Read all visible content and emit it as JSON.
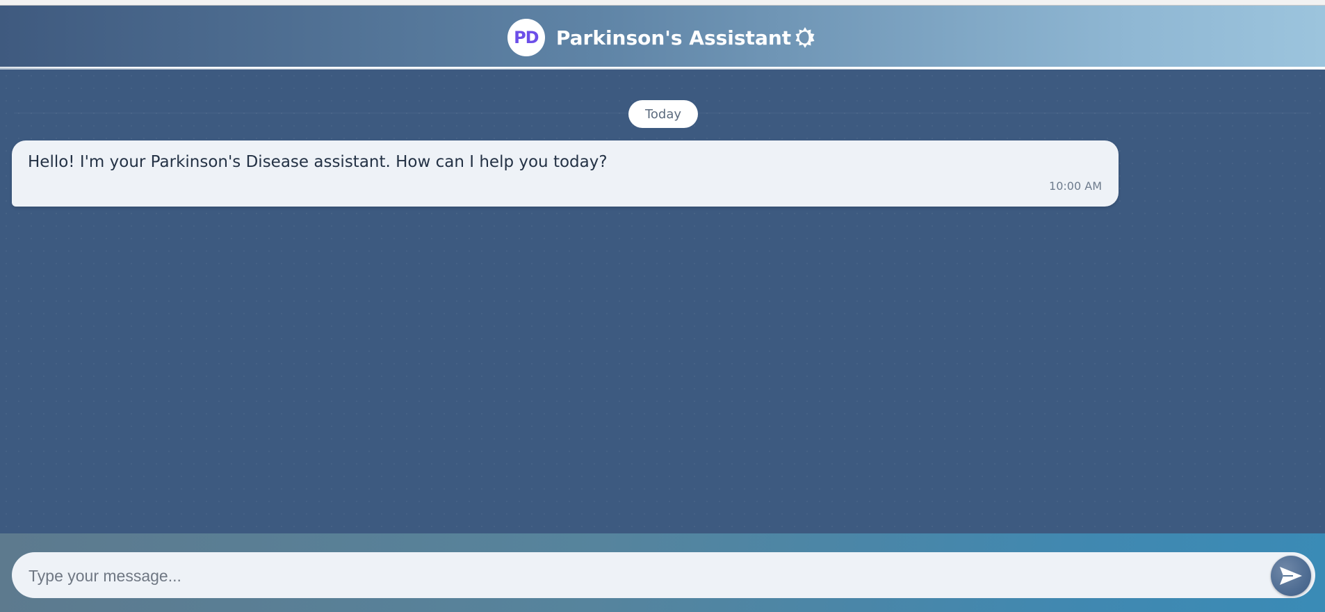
{
  "header": {
    "avatar_initials": "PD",
    "title": "Parkinson's Assistant",
    "theme_toggle_icon": "theme-toggle-icon"
  },
  "chat": {
    "date_separator": "Today",
    "messages": [
      {
        "sender": "assistant",
        "text": "Hello! I'm your Parkinson's Disease assistant. How can I help you today?",
        "time": "10:00 AM"
      }
    ]
  },
  "composer": {
    "placeholder": "Type your message...",
    "value": "",
    "send_icon": "send-icon"
  },
  "colors": {
    "chat_background": "#3d5a80",
    "avatar_text": "#6c4ee8",
    "bubble_background": "#eef2f7"
  }
}
